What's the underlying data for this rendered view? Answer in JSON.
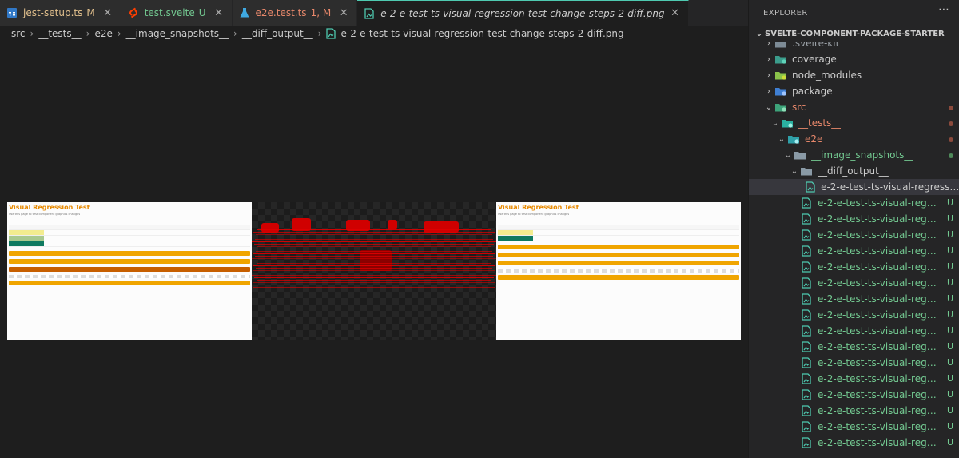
{
  "tabs": [
    {
      "name": "jest-setup.ts",
      "status": "M",
      "icon": "ts-file-icon",
      "color": "#e2c08d",
      "iconColor": "#3178c6",
      "active": false
    },
    {
      "name": "test.svelte",
      "status": "U",
      "icon": "svelte-file-icon",
      "color": "#73c991",
      "iconColor": "#ff3e00",
      "active": false
    },
    {
      "name": "e2e.test.ts",
      "status": "1, M",
      "icon": "flask-test-icon",
      "color": "#e8886b",
      "iconColor": "#3fa8e0",
      "active": false
    },
    {
      "name": "e-2-e-test-ts-visual-regression-test-change-steps-2-diff.png",
      "status": "",
      "icon": "image-file-icon",
      "color": "#cccccc",
      "iconColor": "#4ec9b0",
      "active": true
    }
  ],
  "editor_actions": {
    "split_icon": "split-editor-icon",
    "more_icon": "more-actions-icon"
  },
  "breadcrumb": [
    "src",
    "__tests__",
    "e2e",
    "__image_snapshots__",
    "__diff_output__",
    "e-2-e-test-ts-visual-regression-test-change-steps-2-diff.png"
  ],
  "snapshot": {
    "title": "Visual Regression Test",
    "subtitle": "Use this page to test component graphics changes"
  },
  "explorer": {
    "title": "EXPLORER",
    "section": "SVELTE-COMPONENT-PACKAGE-STARTER",
    "tree": [
      {
        "label": ".svelte-kit",
        "depth": 0,
        "chevron": "›",
        "icon": "folder-icon",
        "color": "#9aa0a6",
        "dot": ""
      },
      {
        "label": "coverage",
        "depth": 0,
        "chevron": "›",
        "icon": "folder-coverage-icon",
        "color": "#cccccc",
        "dot": ""
      },
      {
        "label": "node_modules",
        "depth": 0,
        "chevron": "›",
        "icon": "folder-node-icon",
        "color": "#cccccc",
        "dot": ""
      },
      {
        "label": "package",
        "depth": 0,
        "chevron": "›",
        "icon": "folder-package-icon",
        "color": "#cccccc",
        "dot": ""
      },
      {
        "label": "src",
        "depth": 0,
        "chevron": "⌄",
        "icon": "folder-src-icon",
        "color": "#e8886b",
        "dot": "#8b4a3c"
      },
      {
        "label": "__tests__",
        "depth": 1,
        "chevron": "⌄",
        "icon": "folder-test-icon",
        "color": "#e8886b",
        "dot": "#8b4a3c"
      },
      {
        "label": "e2e",
        "depth": 2,
        "chevron": "⌄",
        "icon": "folder-e2e-icon",
        "color": "#e8886b",
        "dot": "#8b4a3c"
      },
      {
        "label": "__image_snapshots__",
        "depth": 3,
        "chevron": "⌄",
        "icon": "folder-images-icon",
        "color": "#73c991",
        "dot": "#4f8a5a"
      },
      {
        "label": "__diff_output__",
        "depth": 4,
        "chevron": "⌄",
        "icon": "folder-open-icon",
        "color": "#cccccc",
        "dot": ""
      },
      {
        "label": "e-2-e-test-ts-visual-regression-t...",
        "depth": 5,
        "chevron": "",
        "icon": "image-file-icon",
        "color": "#cccccc",
        "dot": "",
        "selected": true
      },
      {
        "label": "e-2-e-test-ts-visual-regressio...",
        "depth": 4,
        "chevron": "",
        "icon": "image-file-icon",
        "color": "#73c991",
        "status": "U"
      },
      {
        "label": "e-2-e-test-ts-visual-regressio...",
        "depth": 4,
        "chevron": "",
        "icon": "image-file-icon",
        "color": "#73c991",
        "status": "U"
      },
      {
        "label": "e-2-e-test-ts-visual-regressio...",
        "depth": 4,
        "chevron": "",
        "icon": "image-file-icon",
        "color": "#73c991",
        "status": "U"
      },
      {
        "label": "e-2-e-test-ts-visual-regressio...",
        "depth": 4,
        "chevron": "",
        "icon": "image-file-icon",
        "color": "#73c991",
        "status": "U"
      },
      {
        "label": "e-2-e-test-ts-visual-regressio...",
        "depth": 4,
        "chevron": "",
        "icon": "image-file-icon",
        "color": "#73c991",
        "status": "U"
      },
      {
        "label": "e-2-e-test-ts-visual-regressio...",
        "depth": 4,
        "chevron": "",
        "icon": "image-file-icon",
        "color": "#73c991",
        "status": "U"
      },
      {
        "label": "e-2-e-test-ts-visual-regressio...",
        "depth": 4,
        "chevron": "",
        "icon": "image-file-icon",
        "color": "#73c991",
        "status": "U"
      },
      {
        "label": "e-2-e-test-ts-visual-regressio...",
        "depth": 4,
        "chevron": "",
        "icon": "image-file-icon",
        "color": "#73c991",
        "status": "U"
      },
      {
        "label": "e-2-e-test-ts-visual-regressio...",
        "depth": 4,
        "chevron": "",
        "icon": "image-file-icon",
        "color": "#73c991",
        "status": "U"
      },
      {
        "label": "e-2-e-test-ts-visual-regressio...",
        "depth": 4,
        "chevron": "",
        "icon": "image-file-icon",
        "color": "#73c991",
        "status": "U"
      },
      {
        "label": "e-2-e-test-ts-visual-regressio...",
        "depth": 4,
        "chevron": "",
        "icon": "image-file-icon",
        "color": "#73c991",
        "status": "U"
      },
      {
        "label": "e-2-e-test-ts-visual-regressio...",
        "depth": 4,
        "chevron": "",
        "icon": "image-file-icon",
        "color": "#73c991",
        "status": "U"
      },
      {
        "label": "e-2-e-test-ts-visual-regressio...",
        "depth": 4,
        "chevron": "",
        "icon": "image-file-icon",
        "color": "#73c991",
        "status": "U"
      },
      {
        "label": "e-2-e-test-ts-visual-regressio...",
        "depth": 4,
        "chevron": "",
        "icon": "image-file-icon",
        "color": "#73c991",
        "status": "U"
      },
      {
        "label": "e-2-e-test-ts-visual-regressio...",
        "depth": 4,
        "chevron": "",
        "icon": "image-file-icon",
        "color": "#73c991",
        "status": "U"
      },
      {
        "label": "e-2-e-test-ts-visual-regressio...",
        "depth": 4,
        "chevron": "",
        "icon": "image-file-icon",
        "color": "#73c991",
        "status": "U"
      }
    ]
  }
}
